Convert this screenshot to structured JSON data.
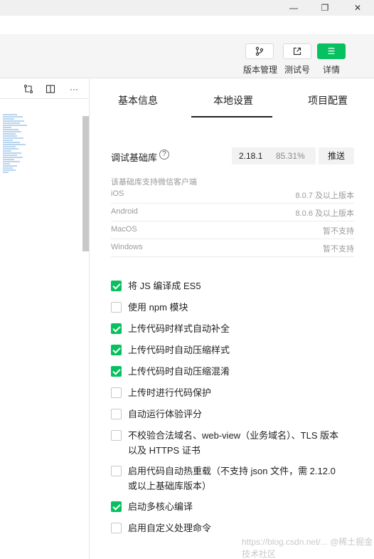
{
  "window": {
    "min_glyph": "—",
    "max_glyph": "❐",
    "close_glyph": "✕"
  },
  "toolbar": {
    "version_mgmt_label": "版本管理",
    "test_account_label": "测试号",
    "details_label": "详情",
    "details_glyph": "☰"
  },
  "editor": {
    "more_glyph": "···"
  },
  "tabs": [
    "基本信息",
    "本地设置",
    "项目配置"
  ],
  "active_tab": "本地设置",
  "debug_lib": {
    "label": "调试基础库",
    "help_glyph": "?",
    "version": "2.18.1",
    "percent": "85.31%",
    "push_label": "推送"
  },
  "support": {
    "note": "该基础库支持微信客户端",
    "rows": [
      {
        "os": "iOS",
        "value": "8.0.7 及以上版本"
      },
      {
        "os": "Android",
        "value": "8.0.6 及以上版本"
      },
      {
        "os": "MacOS",
        "value": "暂不支持"
      },
      {
        "os": "Windows",
        "value": "暂不支持"
      }
    ]
  },
  "options": [
    {
      "label": "将 JS 编译成 ES5",
      "checked": true
    },
    {
      "label": "使用 npm 模块",
      "checked": false
    },
    {
      "label": "上传代码时样式自动补全",
      "checked": true
    },
    {
      "label": "上传代码时自动压缩样式",
      "checked": true
    },
    {
      "label": "上传代码时自动压缩混淆",
      "checked": true
    },
    {
      "label": "上传时进行代码保护",
      "checked": false
    },
    {
      "label": "自动运行体验评分",
      "checked": false
    },
    {
      "label": "不校验合法域名、web-view（业务域名）、TLS 版本以及 HTTPS 证书",
      "checked": false
    },
    {
      "label": "启用代码自动热重载（不支持 json 文件，需 2.12.0 或以上基础库版本）",
      "checked": false
    },
    {
      "label": "启动多核心编译",
      "checked": true
    },
    {
      "label": "启用自定义处理命令",
      "checked": false
    }
  ],
  "watermark": "https://blog.csdn.net/... @稀土掘金技术社区",
  "colors": {
    "accent_green": "#07c160",
    "muted_text": "#9a9a9a"
  }
}
